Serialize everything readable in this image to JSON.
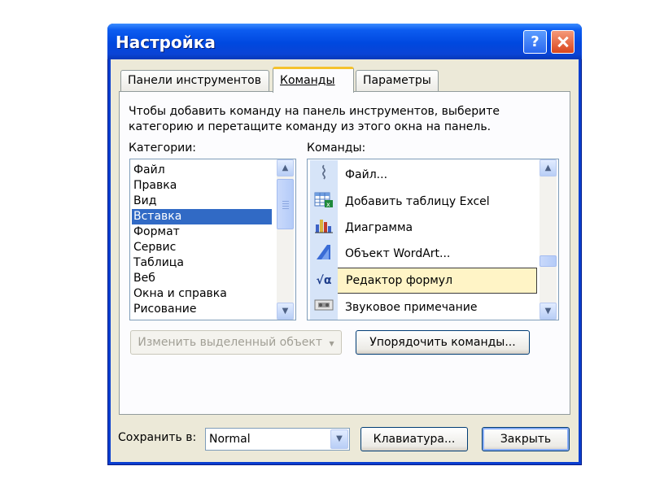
{
  "window": {
    "title": "Настройка",
    "help_glyph": "?"
  },
  "tabs": [
    {
      "label": "Панели инструментов",
      "active": false
    },
    {
      "label": "Команды",
      "active": true
    },
    {
      "label": "Параметры",
      "active": false
    }
  ],
  "description": "Чтобы добавить команду на панель инструментов, выберите категорию и перетащите команду из этого окна на панель.",
  "categories": {
    "label": "Категории:",
    "items": [
      "Файл",
      "Правка",
      "Вид",
      "Вставка",
      "Формат",
      "Сервис",
      "Таблица",
      "Веб",
      "Окна и справка",
      "Рисование"
    ],
    "selected": "Вставка"
  },
  "commands": {
    "label": "Команды:",
    "items": [
      {
        "label": "Файл...",
        "icon": "paperclip-icon"
      },
      {
        "label": "Добавить таблицу Excel",
        "icon": "excel-table-icon"
      },
      {
        "label": "Диаграмма",
        "icon": "chart-icon"
      },
      {
        "label": "Объект WordArt...",
        "icon": "wordart-icon"
      },
      {
        "label": "Редактор формул",
        "icon": "formula-editor-icon"
      },
      {
        "label": "Звуковое примечание",
        "icon": "sound-note-icon"
      }
    ],
    "selected": "Редактор формул"
  },
  "buttons": {
    "modify_selection": "Изменить выделенный объект",
    "rearrange_commands": "Упорядочить команды...",
    "keyboard": "Клавиатура...",
    "close": "Закрыть"
  },
  "save_in": {
    "label": "Сохранить в:",
    "value": "Normal"
  },
  "scroll_glyphs": {
    "up": "▲",
    "down": "▼",
    "dropdown": "▼"
  },
  "colors": {
    "title_bar": "#0048df",
    "selection": "#316ac5",
    "active_tab_accent": "#f5c22c",
    "dialog_bg": "#ece9d8"
  }
}
